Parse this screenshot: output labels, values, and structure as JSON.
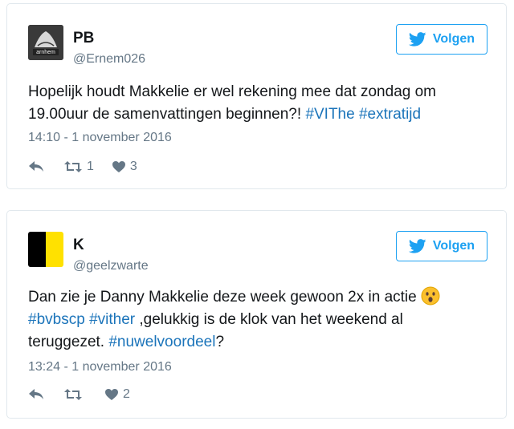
{
  "tweets": [
    {
      "display_name": "PB",
      "handle": "@Ernem026",
      "avatar_icon": "adidas-trefoil-arnhem-logo",
      "avatar_logo_text": "arnhem",
      "follow_label": "Volgen",
      "text_plain": "Hopelijk houdt Makkelie er wel rekening mee dat zondag om 19.00uur de samenvattingen beginnen?! ",
      "hashtag_1": "#VIThe",
      "hashtag_2": "#extratijd",
      "timestamp": "14:10 - 1 november 2016",
      "retweet_count": "1",
      "like_count": "3"
    },
    {
      "display_name": "K",
      "handle": "@geelzwarte",
      "avatar_icon": "black-yellow-stripes",
      "follow_label": "Volgen",
      "text_part_1": "Dan zie je Danny Makkelie deze week gewoon 2x in actie ",
      "emoji": "surprised-face-emoji",
      "hashtag_1": "#bvbscp",
      "hashtag_2": "#vither",
      "text_part_2": " ,gelukkig is de klok van het weekend al teruggezet. ",
      "hashtag_3": "#nuwelvoordeel",
      "text_part_3": "?",
      "timestamp": "13:24 - 1 november 2016",
      "retweet_count": "",
      "like_count": "2"
    }
  ],
  "colors": {
    "accent": "#1da1f2",
    "hashtag": "#1b74ba",
    "muted": "#657786",
    "border": "#e1e8ed"
  }
}
